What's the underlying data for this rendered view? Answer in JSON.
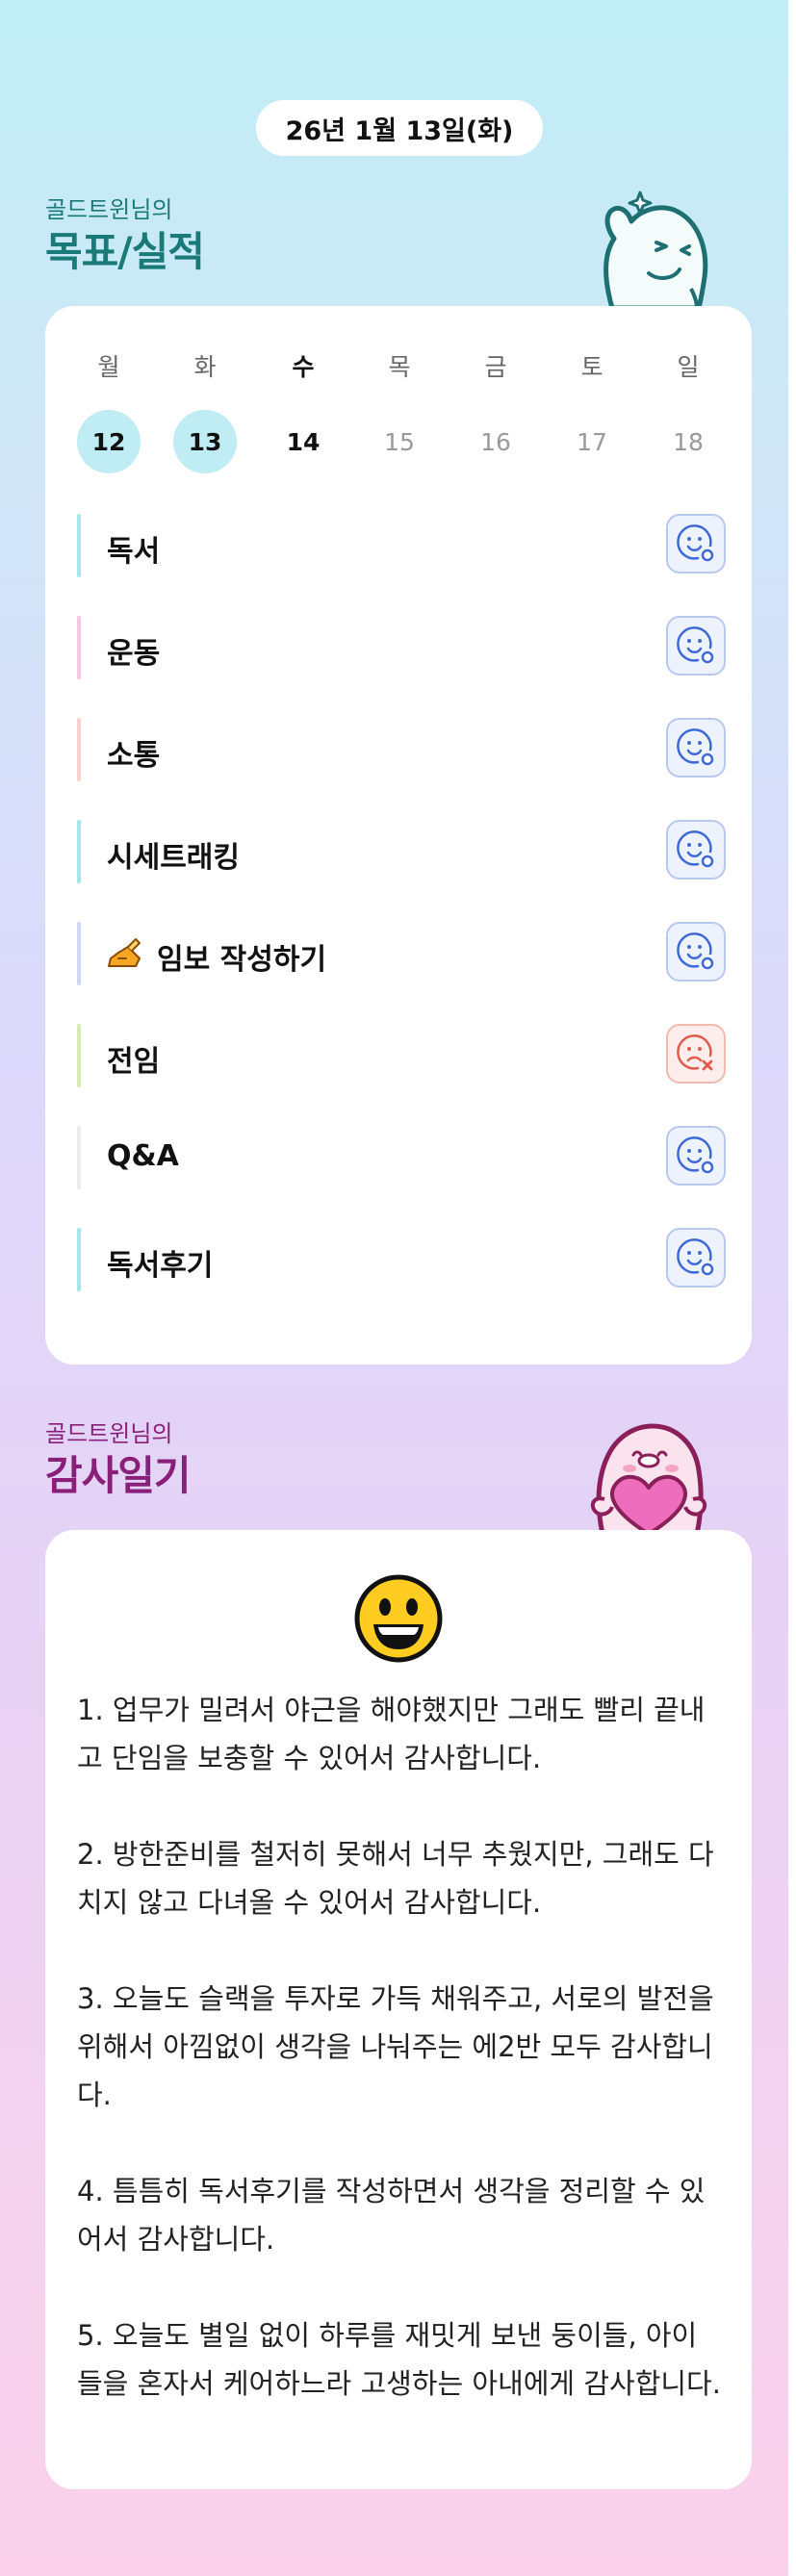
{
  "date_pill": "26년 1월 13일(화)",
  "goals_section": {
    "subtitle": "골드트윈님의",
    "title": "목표/실적"
  },
  "week": {
    "days": [
      "월",
      "화",
      "수",
      "목",
      "금",
      "토",
      "일"
    ],
    "dates": [
      "12",
      "13",
      "14",
      "15",
      "16",
      "17",
      "18"
    ],
    "states": [
      "done",
      "done",
      "today",
      "future",
      "future",
      "future",
      "future"
    ]
  },
  "goals": [
    {
      "label": "독서",
      "bar_color": "#a6e8e9",
      "status": "smile"
    },
    {
      "label": "운동",
      "bar_color": "#f6c6e3",
      "status": "smile"
    },
    {
      "label": "소통",
      "bar_color": "#fbd0cc",
      "status": "smile"
    },
    {
      "label": "시세트래킹",
      "bar_color": "#a6e8e9",
      "status": "smile"
    },
    {
      "label": "임보 작성하기",
      "icon": "writing-hand-icon",
      "bar_color": "#d1d7f6",
      "status": "smile"
    },
    {
      "label": "전임",
      "bar_color": "#d8ebb4",
      "status": "fail"
    },
    {
      "label": "Q&A",
      "bar_color": "#ececec",
      "status": "smile"
    },
    {
      "label": "독서후기",
      "bar_color": "#a6e8e9",
      "status": "smile"
    }
  ],
  "gratitude_section": {
    "subtitle": "골드트윈님의",
    "title": "감사일기",
    "emoji": "grinning-face-icon"
  },
  "gratitude": [
    "1. 업무가 밀려서 야근을 해야했지만 그래도 빨리 끝내고 단임을 보충할 수 있어서 감사합니다.",
    "2. 방한준비를 철저히 못해서 너무 추웠지만, 그래도 다치지 않고 다녀올 수 있어서 감사합니다.",
    "3. 오늘도 슬랙을 투자로 가득 채워주고, 서로의 발전을 위해서 아낌없이 생각을 나눠주는 에2반 모두 감사합니다.",
    "4. 틈틈히 독서후기를 작성하면서 생각을 정리할 수 있어서 감사합니다.",
    "5. 오늘도 별일 없이 하루를 재밋게 보낸 둥이들, 아이들을 혼자서 케어하느라 고생하는 아내에게 감사합니다."
  ],
  "colors": {
    "teal": "#1a7a78",
    "purple": "#8a1f7a",
    "circle": "#c0ecf3",
    "smile_blue": "#3e6ad8",
    "fail_red": "#e25b4a"
  }
}
